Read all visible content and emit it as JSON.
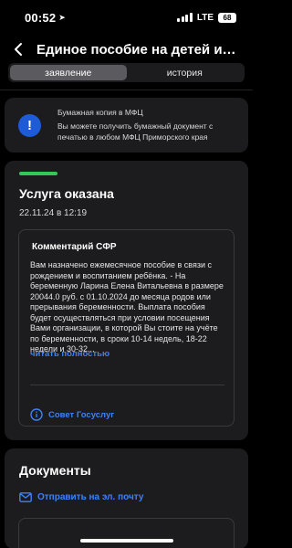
{
  "status_bar": {
    "time": "00:52",
    "network": "LTE",
    "battery": "68"
  },
  "header": {
    "title": "Единое пособие на детей и бе..."
  },
  "tabs": [
    {
      "label": "заявление",
      "active": true
    },
    {
      "label": "история",
      "active": false
    }
  ],
  "notice": {
    "title": "Бумажная копия в МФЦ",
    "body": "Вы можете получить бумажный документ с печатью в любом МФЦ Приморского края"
  },
  "service": {
    "status": "Услуга оказана",
    "date": "22.11.24 в 12:19",
    "status_color": "#34c759"
  },
  "comment": {
    "title": "Комментарий СФР",
    "body": "Вам назначено ежемесячное пособие в связи с рождением и воспитанием ребёнка. - На беременную Ларина Елена Витальевна в размере 20044.0 руб. с 01.10.2024 до месяца родов или прерывания беременности. Выплата пособия будет осуществляться при условии посещения Вами организации, в которой Вы стоите на учёте по беременности, в сроки 10-14 недель, 18-22 недели и 30-32...",
    "read_more": "читать полностью",
    "advice": "Совет Госуслуг"
  },
  "documents": {
    "title": "Документы",
    "send_email": "Отправить на эл. почту"
  },
  "colors": {
    "accent": "#3b82f6",
    "card": "#1c1c1e",
    "info": "#1e5bd6"
  }
}
